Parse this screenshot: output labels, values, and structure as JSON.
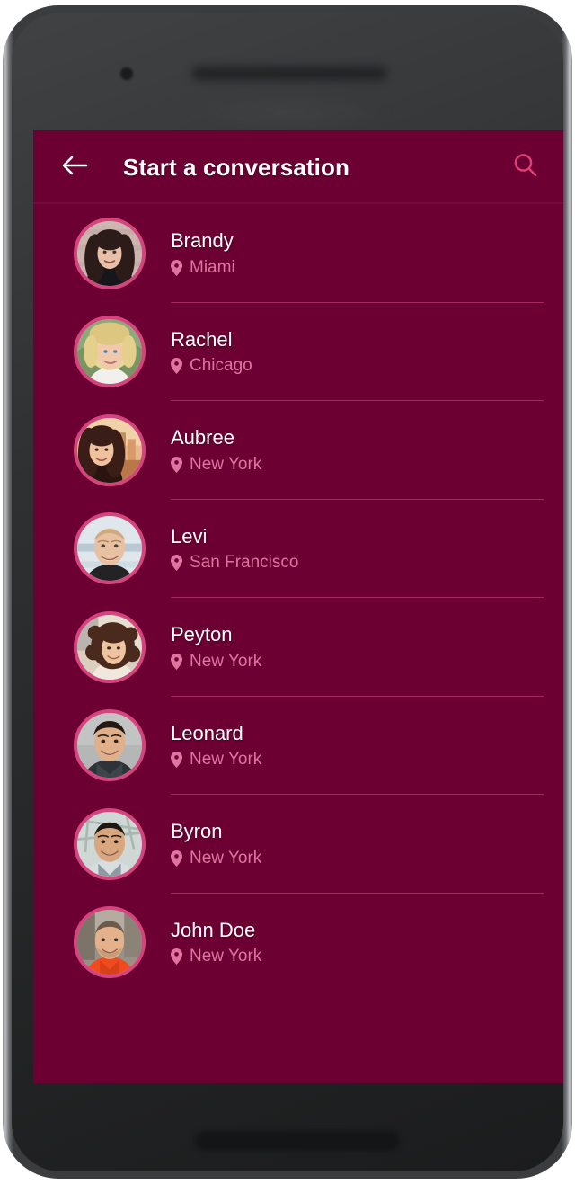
{
  "device": {
    "camera_icon": "front-camera",
    "earpiece_icon": "earpiece-speaker",
    "home_button_icon": "home-button"
  },
  "theme": {
    "screen_background": "#6d0033",
    "appbar_background": "#6d0033",
    "accent_pink": "#e0739f",
    "avatar_ring": "#d6447e",
    "divider": "#a8275c",
    "title_color": "#ffffff",
    "search_icon_color": "#e0417a"
  },
  "appbar": {
    "back_icon": "arrow-left-icon",
    "title": "Start a conversation",
    "search_icon": "search-icon"
  },
  "contacts": {
    "location_icon": "map-pin-icon",
    "items": [
      {
        "name": "Brandy",
        "location": "Miami",
        "avatar": "avatar-brandy"
      },
      {
        "name": "Rachel",
        "location": "Chicago",
        "avatar": "avatar-rachel"
      },
      {
        "name": "Aubree",
        "location": "New York",
        "avatar": "avatar-aubree"
      },
      {
        "name": "Levi",
        "location": "San Francisco",
        "avatar": "avatar-levi"
      },
      {
        "name": "Peyton",
        "location": "New York",
        "avatar": "avatar-peyton"
      },
      {
        "name": "Leonard",
        "location": "New York",
        "avatar": "avatar-leonard"
      },
      {
        "name": "Byron",
        "location": "New York",
        "avatar": "avatar-byron"
      },
      {
        "name": "John Doe",
        "location": "New York",
        "avatar": "avatar-john-doe"
      }
    ]
  }
}
